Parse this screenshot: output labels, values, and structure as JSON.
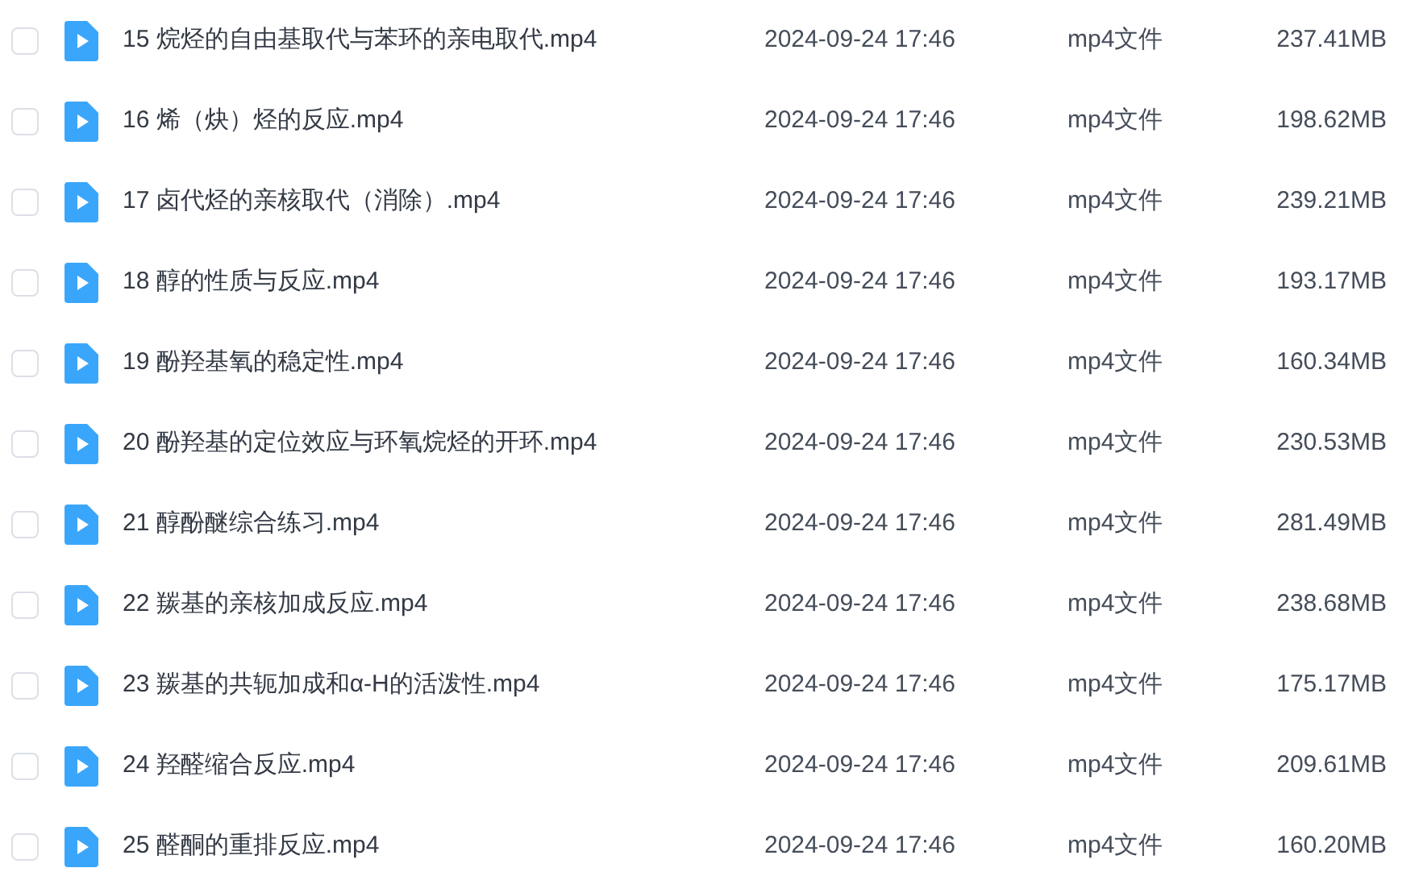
{
  "files": [
    {
      "name": "15 烷烃的自由基取代与苯环的亲电取代.mp4",
      "modified": "2024-09-24 17:46",
      "type": "mp4文件",
      "size": "237.41MB",
      "checked": false
    },
    {
      "name": "16 烯（炔）烃的反应.mp4",
      "modified": "2024-09-24 17:46",
      "type": "mp4文件",
      "size": "198.62MB",
      "checked": false
    },
    {
      "name": "17 卤代烃的亲核取代（消除）.mp4",
      "modified": "2024-09-24 17:46",
      "type": "mp4文件",
      "size": "239.21MB",
      "checked": false
    },
    {
      "name": "18 醇的性质与反应.mp4",
      "modified": "2024-09-24 17:46",
      "type": "mp4文件",
      "size": "193.17MB",
      "checked": false
    },
    {
      "name": "19 酚羟基氧的稳定性.mp4",
      "modified": "2024-09-24 17:46",
      "type": "mp4文件",
      "size": "160.34MB",
      "checked": false
    },
    {
      "name": "20 酚羟基的定位效应与环氧烷烃的开环.mp4",
      "modified": "2024-09-24 17:46",
      "type": "mp4文件",
      "size": "230.53MB",
      "checked": false
    },
    {
      "name": "21 醇酚醚综合练习.mp4",
      "modified": "2024-09-24 17:46",
      "type": "mp4文件",
      "size": "281.49MB",
      "checked": false
    },
    {
      "name": "22 羰基的亲核加成反应.mp4",
      "modified": "2024-09-24 17:46",
      "type": "mp4文件",
      "size": "238.68MB",
      "checked": false
    },
    {
      "name": "23 羰基的共轭加成和α-H的活泼性.mp4",
      "modified": "2024-09-24 17:46",
      "type": "mp4文件",
      "size": "175.17MB",
      "checked": false
    },
    {
      "name": "24 羟醛缩合反应.mp4",
      "modified": "2024-09-24 17:46",
      "type": "mp4文件",
      "size": "209.61MB",
      "checked": false
    },
    {
      "name": "25 醛酮的重排反应.mp4",
      "modified": "2024-09-24 17:46",
      "type": "mp4文件",
      "size": "160.20MB",
      "checked": false
    }
  ]
}
